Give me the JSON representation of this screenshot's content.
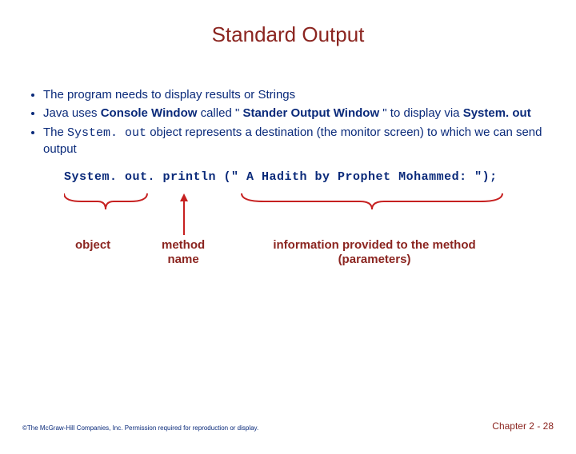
{
  "title": "Standard Output",
  "bullets": {
    "b1": "The program needs to display results or Strings",
    "b2_pre": "Java uses ",
    "b2_cw": "Console Window",
    "b2_mid": " called \" ",
    "b2_sow": "Stander Output Window",
    "b2_post1": " \" to display via ",
    "b2_sys": "System. out",
    "b3_pre": "The ",
    "b3_sys": "System. out",
    "b3_post": " object represents a destination (the monitor screen) to which we can send output"
  },
  "code": "System. out. println (\" A Hadith by Prophet Mohammed: \");",
  "labels": {
    "object": "object",
    "method": "method\nname",
    "info": "information provided to the method\n(parameters)"
  },
  "footer": {
    "copyright": "©The McGraw-Hill Companies, Inc. Permission required for reproduction or display.",
    "page": "Chapter 2 - 28"
  }
}
